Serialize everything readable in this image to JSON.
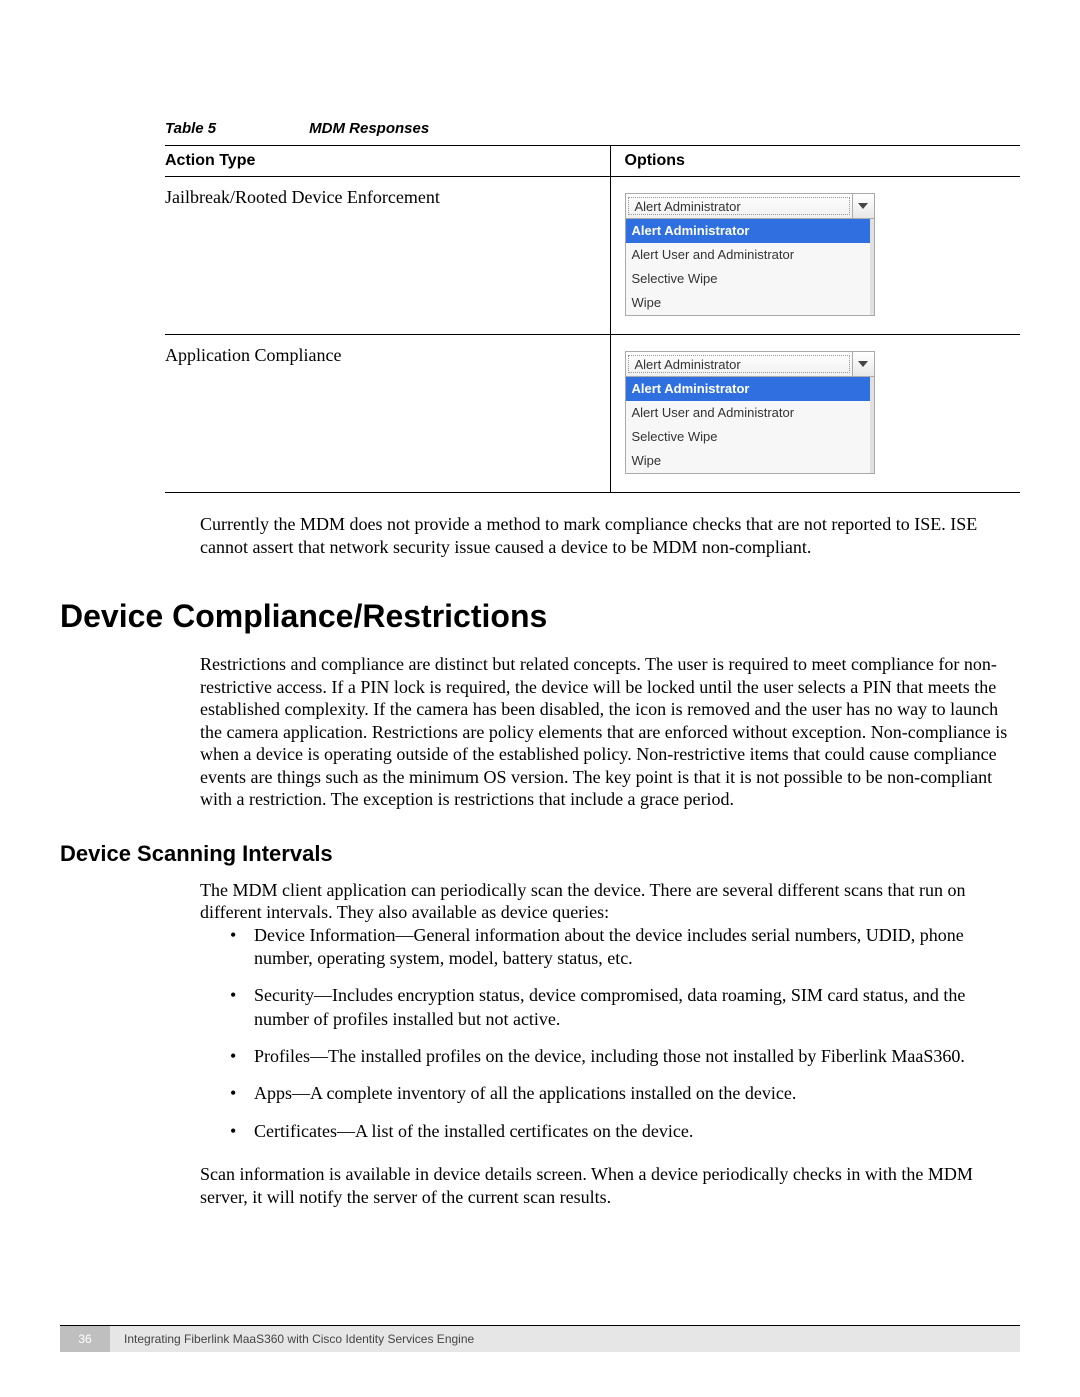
{
  "table": {
    "caption_id": "Table 5",
    "caption_title": "MDM Responses",
    "headers": {
      "action": "Action Type",
      "options": "Options"
    },
    "rows": [
      {
        "action": "Jailbreak/Rooted Device Enforcement",
        "dropdown": {
          "selected_display": "Alert Administrator",
          "items": [
            "Alert Administrator",
            "Alert User and Administrator",
            "Selective Wipe",
            "Wipe"
          ],
          "highlighted_index": 0
        }
      },
      {
        "action": "Application Compliance",
        "dropdown": {
          "selected_display": "Alert Administrator",
          "items": [
            "Alert Administrator",
            "Alert User and Administrator",
            "Selective Wipe",
            "Wipe"
          ],
          "highlighted_index": 0
        }
      }
    ]
  },
  "para_after_table": "Currently the MDM does not provide a method to mark compliance checks that are not reported to ISE. ISE cannot assert that network security issue caused a device to be MDM non-compliant.",
  "section1": {
    "title": "Device Compliance/Restrictions",
    "para": "Restrictions and compliance are distinct but related concepts. The user is required to meet compliance for non-restrictive access. If a PIN lock is required, the device will be locked until the user selects a PIN that meets the established complexity. If the camera has been disabled, the icon is removed and the user has no way to launch the camera application. Restrictions are policy elements that are enforced without exception. Non-compliance is when a device is operating outside of the established policy. Non-restrictive items that could cause compliance events are things such as the minimum OS version. The key point is that it is not possible to be non-compliant with a restriction. The exception is restrictions that include a grace period."
  },
  "section2": {
    "title": "Device Scanning Intervals",
    "intro": "The MDM client application can periodically scan the device. There are several different scans that run on different intervals. They also available as device queries:",
    "bullets": [
      "Device Information—General information about the device includes serial numbers, UDID, phone number, operating system, model, battery status, etc.",
      "Security—Includes encryption status, device compromised, data roaming, SIM card status, and the number of profiles installed but not active.",
      "Profiles—The installed profiles on the device, including those not installed by Fiberlink MaaS360.",
      "Apps—A complete inventory of all the applications installed on the device.",
      "Certificates—A list of the installed certificates on the device."
    ],
    "outro": "Scan information is available in device details screen. When a device periodically checks in with the MDM server, it will notify the server of the current scan results."
  },
  "footer": {
    "page": "36",
    "title": "Integrating Fiberlink MaaS360 with Cisco Identity Services Engine"
  }
}
